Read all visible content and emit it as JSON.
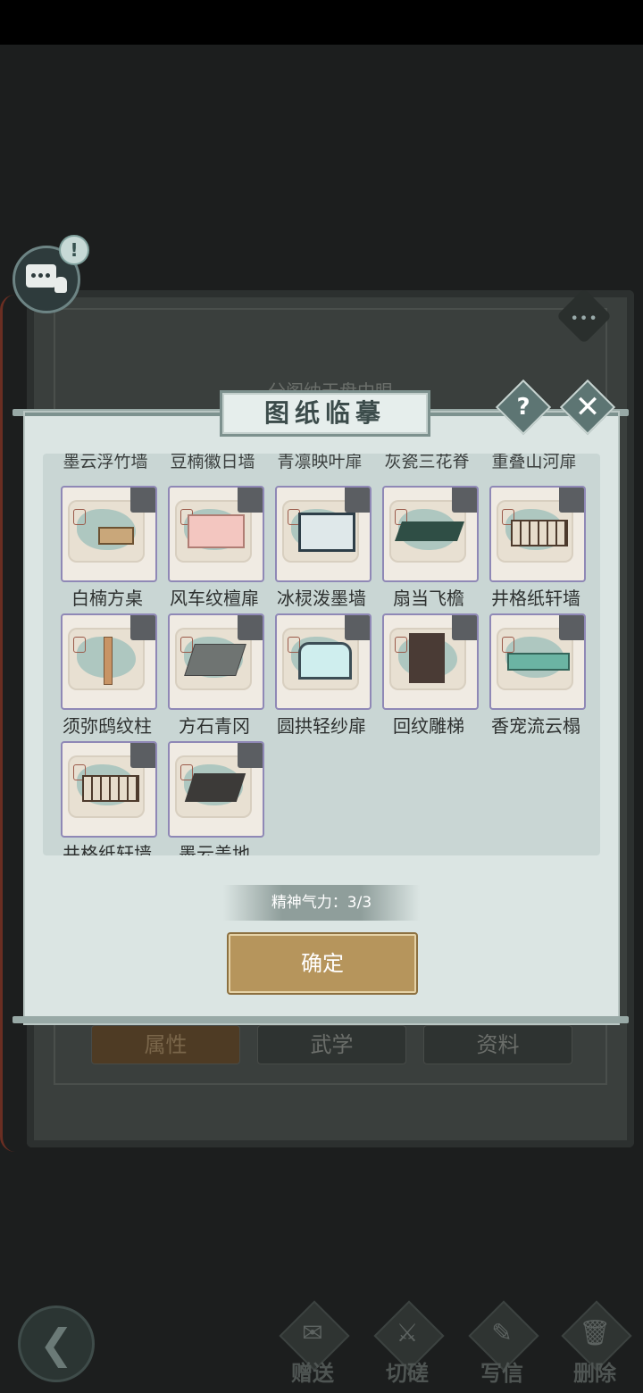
{
  "background": {
    "title_text": "分阁纳天盘中眼",
    "tabs": [
      "属性",
      "武学",
      "资料"
    ]
  },
  "chat": {
    "alert_glyph": "!"
  },
  "panel": {
    "title": "图纸临摹",
    "help_glyph": "?",
    "close_glyph": "✕",
    "previous_row_names": [
      "墨云浮竹墙",
      "豆楠徽日墙",
      "青凛映叶扉",
      "灰瓷三花脊",
      "重叠山河扉"
    ],
    "items": [
      {
        "name": "白楠方桌",
        "icon": "square-table-icon"
      },
      {
        "name": "风车纹檀扉",
        "icon": "pink-screen-door-icon"
      },
      {
        "name": "冰棂泼墨墙",
        "icon": "ink-wall-icon"
      },
      {
        "name": "扇当飞檐",
        "icon": "flying-eave-roof-icon"
      },
      {
        "name": "井格纸轩墙",
        "icon": "lattice-paper-wall-icon"
      },
      {
        "name": "须弥鸱纹柱",
        "icon": "pillar-icon"
      },
      {
        "name": "方石青冈",
        "icon": "stone-floor-tile-icon"
      },
      {
        "name": "圆拱轻纱扉",
        "icon": "arched-gauze-door-icon"
      },
      {
        "name": "回纹雕梯",
        "icon": "carved-stairs-icon"
      },
      {
        "name": "香宠流云榻",
        "icon": "cloud-couch-icon"
      },
      {
        "name": "井格纸轩墙",
        "icon": "lattice-paper-wall-icon"
      },
      {
        "name": "墨云盖地",
        "icon": "dark-floor-tile-icon"
      }
    ],
    "energy_text": "精神气力：3/3",
    "confirm_label": "确定"
  },
  "bottom_bar": {
    "back_glyph": "❮",
    "actions": [
      {
        "label": "赠送",
        "icon": "scroll-gift-icon"
      },
      {
        "label": "切磋",
        "icon": "crossed-swords-icon"
      },
      {
        "label": "写信",
        "icon": "letter-icon"
      },
      {
        "label": "删除",
        "icon": "trash-icon"
      }
    ]
  }
}
